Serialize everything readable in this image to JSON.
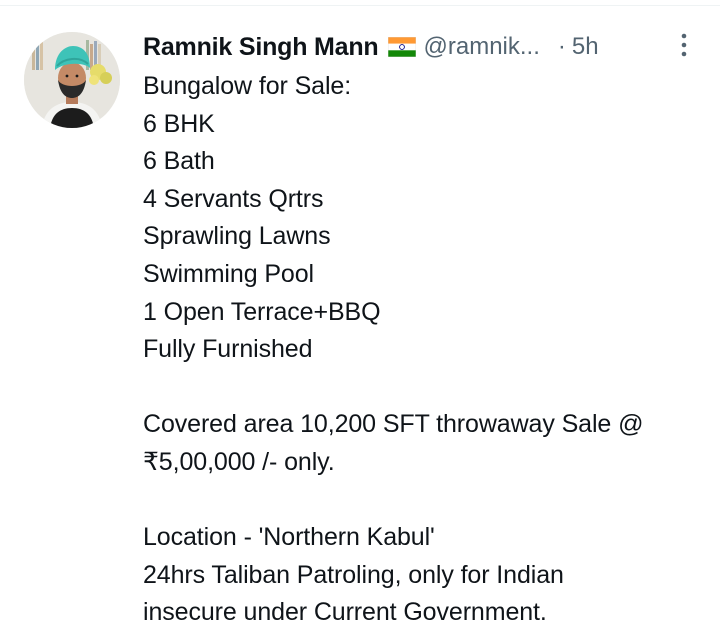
{
  "tweet": {
    "author_name": "Ramnik Singh Mann",
    "author_flag": "india-flag",
    "author_handle": "@ramnik...",
    "separator": "·",
    "time": "5h",
    "lines": {
      "l1": "Bungalow for Sale:",
      "l2": "6 BHK",
      "l3": "6 Bath",
      "l4": "4 Servants Qrtrs",
      "l5": "Sprawling Lawns",
      "l6": "Swimming Pool",
      "l7": "1 Open Terrace+BBQ",
      "l8": "Fully Furnished",
      "l9": "Covered area 10,200 SFT throwaway Sale @",
      "l10": "₹5,00,000 /- only.",
      "l11": "Location - 'Northern Kabul'",
      "l12": "24hrs Taliban Patroling, only for Indian",
      "l13": "insecure under Current Government."
    }
  },
  "icons": {
    "more": "more-vertical-icon",
    "avatar": "profile-avatar"
  },
  "colors": {
    "text": "#0f1419",
    "secondary": "#536471",
    "turban": "#3ec3b8",
    "divider": "#eff3f4"
  }
}
